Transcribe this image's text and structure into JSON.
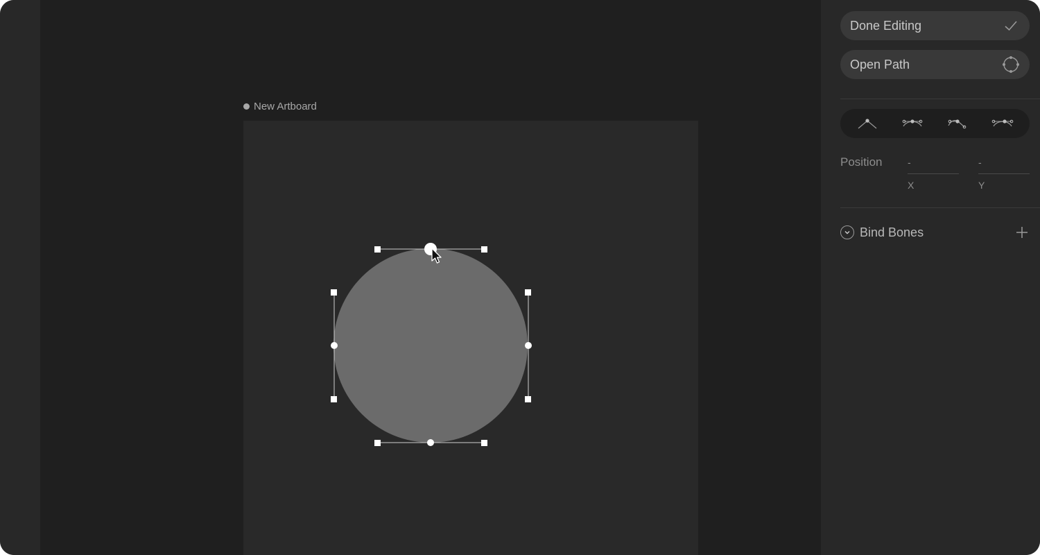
{
  "artboard": {
    "label": "New Artboard"
  },
  "panel": {
    "done_editing_label": "Done Editing",
    "done_editing_icon": "checkmark-icon",
    "open_path_label": "Open Path",
    "open_path_icon": "circle-path-icon",
    "vertex_modes": [
      {
        "name": "straight-vertex-icon"
      },
      {
        "name": "mirrored-vertex-icon"
      },
      {
        "name": "detached-vertex-icon"
      },
      {
        "name": "asymmetric-vertex-icon"
      }
    ],
    "position": {
      "label": "Position",
      "x_value": "-",
      "x_axis": "X",
      "y_value": "-",
      "y_axis": "Y"
    },
    "bind_bones": {
      "label": "Bind Bones",
      "toggle_icon": "chevron-down-icon",
      "add_icon": "plus-icon"
    }
  },
  "colors": {
    "window_bg": "#1f1f1f",
    "artboard_bg": "#292929",
    "panel_bg": "#282828",
    "shape_fill": "#6b6b6b",
    "handle": "#ffffff"
  }
}
